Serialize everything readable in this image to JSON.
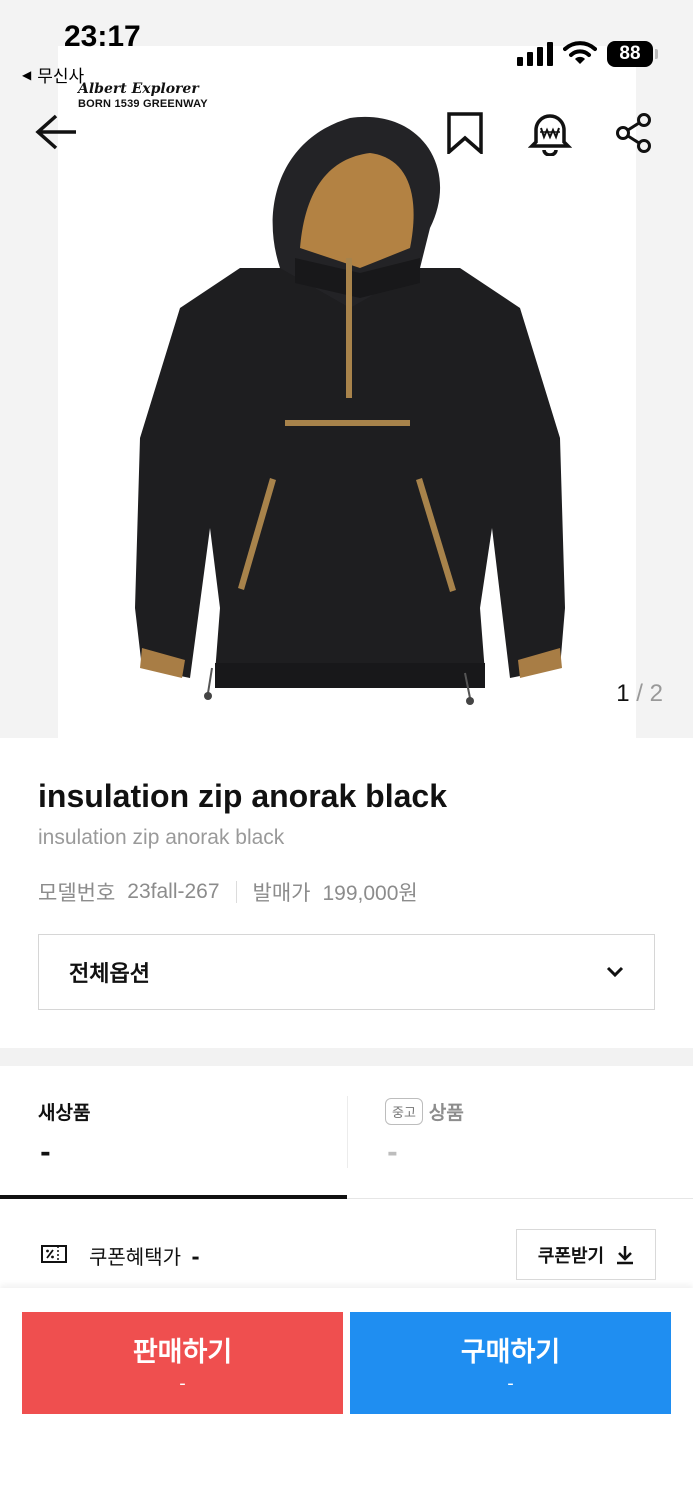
{
  "status_bar": {
    "time": "23:17",
    "back_app": "무신사",
    "battery": "88"
  },
  "brand": {
    "name": "Albert Explorer",
    "sub": "BORN 1539 GREENWAY"
  },
  "image_counter": {
    "current": "1",
    "separator": "/",
    "total": "2"
  },
  "icons": {
    "back": "arrow-left-icon",
    "bookmark": "bookmark-icon",
    "alert": "price-alert-bell-icon",
    "share": "share-icon",
    "options_chevron": "chevron-down-icon",
    "coupon": "coupon-icon",
    "download": "download-icon"
  },
  "product": {
    "title": "insulation zip anorak black",
    "subtitle": "insulation zip anorak black",
    "model_label": "모델번호",
    "model_value": "23fall-267",
    "release_label": "발매가",
    "release_value": "199,000원"
  },
  "options": {
    "label": "전체옵션"
  },
  "tabs": {
    "new": {
      "label": "새상품",
      "price": "-"
    },
    "used": {
      "badge": "중고",
      "label": "상품",
      "price": "-"
    }
  },
  "coupon": {
    "label": "쿠폰혜택가",
    "value": "-",
    "button": "쿠폰받기"
  },
  "actions": {
    "sell": {
      "label": "판매하기",
      "sub": "-",
      "color": "#ef4f4f"
    },
    "buy": {
      "label": "구매하기",
      "sub": "-",
      "color": "#1f8ef1"
    }
  }
}
